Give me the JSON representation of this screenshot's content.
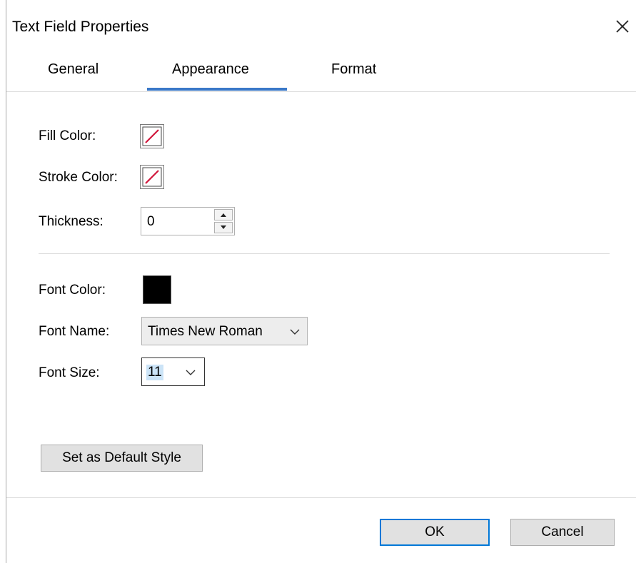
{
  "window": {
    "title": "Text Field Properties",
    "close_icon": "close-icon"
  },
  "tabs": [
    {
      "label": "General",
      "active": false
    },
    {
      "label": "Appearance",
      "active": true
    },
    {
      "label": "Format",
      "active": false
    }
  ],
  "appearance": {
    "fill_color_label": "Fill Color:",
    "fill_color": "none",
    "stroke_color_label": "Stroke Color:",
    "stroke_color": "none",
    "thickness_label": "Thickness:",
    "thickness_value": "0",
    "font_color_label": "Font Color:",
    "font_color": "#000000",
    "font_name_label": "Font Name:",
    "font_name_value": "Times New Roman",
    "font_size_label": "Font Size:",
    "font_size_value": "11",
    "default_style_button": "Set as Default Style"
  },
  "footer": {
    "ok_label": "OK",
    "cancel_label": "Cancel"
  },
  "colors": {
    "accent": "#3a78c8",
    "no_color_slash": "#d1173c",
    "button_bg": "#e1e1e1",
    "primary_border": "#0078d7"
  }
}
